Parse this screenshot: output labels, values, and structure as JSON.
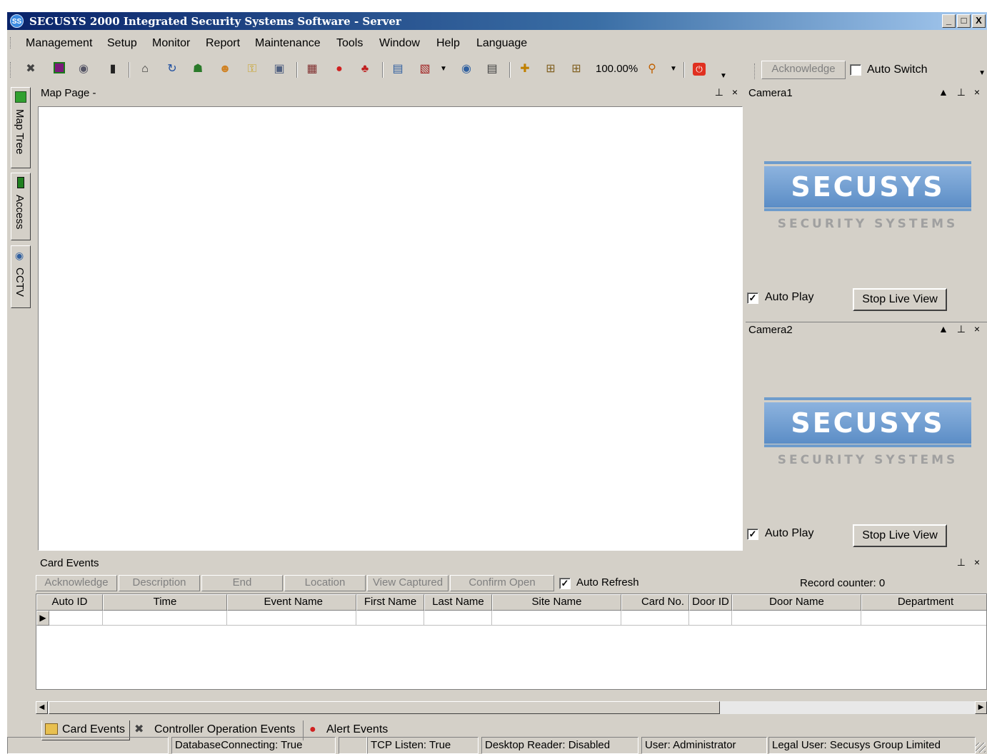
{
  "window": {
    "title": "SECUSYS 2000 Integrated Security Systems Software - Server",
    "icon_text": "SS",
    "buttons": {
      "minimize": "_",
      "maximize": "□",
      "close": "X"
    }
  },
  "menu": [
    {
      "label": "Management",
      "key": "M"
    },
    {
      "label": "Setup",
      "key": "S"
    },
    {
      "label": "Monitor",
      "key": "M"
    },
    {
      "label": "Report",
      "key": "R"
    },
    {
      "label": "Maintenance",
      "key": "t"
    },
    {
      "label": "Tools",
      "key": "T"
    },
    {
      "label": "Window",
      "key": "W"
    },
    {
      "label": "Help",
      "key": "H"
    },
    {
      "label": "Language",
      "key": "L"
    }
  ],
  "toolbar": {
    "zoom": "100.00%",
    "icons": [
      "users-icon",
      "book-icon",
      "camera-icon",
      "reader-icon",
      "door-icon",
      "sync-icon",
      "group-icon",
      "person-icon",
      "key-icon",
      "card-icon",
      "calendar-icon",
      "alarm-icon",
      "network-icon",
      "report-icon",
      "grid-icon",
      "cctv-icon",
      "export-icon",
      "move-icon",
      "align-icon",
      "flow-icon",
      "zoom-icon",
      "power-icon"
    ]
  },
  "ack_toolbar": {
    "acknowledge_label": "Acknowledge",
    "auto_switch_label": "Auto Switch",
    "auto_switch_checked": false
  },
  "side_tabs": [
    {
      "label": "Map Tree",
      "icon": "map-tree-icon"
    },
    {
      "label": "Access",
      "icon": "access-icon"
    },
    {
      "label": "CCTV",
      "icon": "cctv-icon"
    }
  ],
  "map_pane": {
    "title": "Map Page -",
    "controls": "⊥ ×"
  },
  "cameras": [
    {
      "title": "Camera1",
      "controls": "▲ ⊥ ×",
      "logo_main": "SECUSYS",
      "logo_sub": "SECURITY SYSTEMS",
      "auto_play_label": "Auto Play",
      "auto_play": true,
      "stop_label": "Stop Live View"
    },
    {
      "title": "Camera2",
      "controls": "▲ ⊥ ×",
      "logo_main": "SECUSYS",
      "logo_sub": "SECURITY SYSTEMS",
      "auto_play_label": "Auto Play",
      "auto_play": true,
      "stop_label": "Stop Live View"
    }
  ],
  "events": {
    "title": "Card Events",
    "controls": "⊥ ×",
    "buttons": [
      "Acknowledge",
      "Description",
      "End",
      "Location",
      "View Captured",
      "Confirm Open"
    ],
    "auto_refresh_label": "Auto Refresh",
    "auto_refresh": true,
    "record_counter": "Record counter: 0",
    "columns": [
      "Auto ID",
      "Time",
      "Event Name",
      "First Name",
      "Last Name",
      "Site Name",
      "Card No.",
      "Door ID",
      "Door Name",
      "Department"
    ],
    "row_indicator": "▶",
    "tabs": [
      {
        "label": "Card Events",
        "icon": "card-events-icon",
        "active": true
      },
      {
        "label": "Controller Operation Events",
        "icon": "controller-icon",
        "active": false
      },
      {
        "label": "Alert Events",
        "icon": "alert-icon",
        "active": false
      }
    ]
  },
  "status": {
    "db": "DatabaseConnecting: True",
    "tcp": "TCP Listen: True",
    "reader": "Desktop Reader: Disabled",
    "user": "User: Administrator",
    "legal": "Legal User: Secusys Group Limited"
  }
}
